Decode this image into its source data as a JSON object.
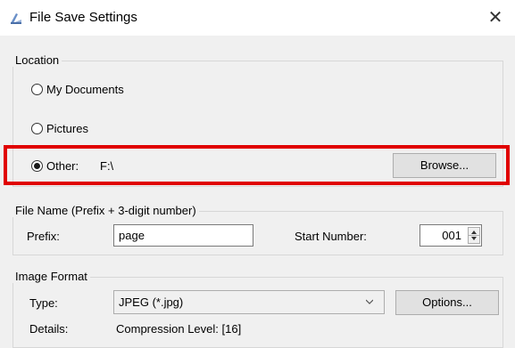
{
  "window": {
    "title": "File Save Settings",
    "close_glyph": "✕"
  },
  "location": {
    "group_label": "Location",
    "options": [
      {
        "label": "My Documents",
        "selected": false
      },
      {
        "label": "Pictures",
        "selected": false
      },
      {
        "label": "Other:",
        "selected": true
      }
    ],
    "other_path": "F:\\",
    "browse_label": "Browse..."
  },
  "file_name": {
    "group_label": "File Name (Prefix + 3-digit number)",
    "prefix_label": "Prefix:",
    "prefix_value": "page",
    "start_number_label": "Start Number:",
    "start_number_value": "001"
  },
  "image_format": {
    "group_label": "Image Format",
    "type_label": "Type:",
    "type_value": "JPEG (*.jpg)",
    "options_label": "Options...",
    "details_label": "Details:",
    "details_value": "Compression Level: [16]"
  },
  "annotation": {
    "highlight_color": "#e00000"
  }
}
